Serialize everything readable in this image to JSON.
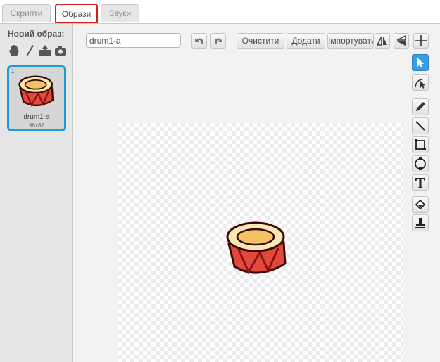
{
  "tabs": [
    {
      "label": "Скрипти"
    },
    {
      "label": "Образи"
    },
    {
      "label": "Звуки"
    }
  ],
  "left_pane": {
    "new_costume_label": "Новий образ:",
    "costume_icons": [
      "sprite-library-icon",
      "paint-brush-icon",
      "upload-icon",
      "camera-icon"
    ],
    "costumes": [
      {
        "number": "1",
        "name": "drum1-a",
        "size": "98x87"
      }
    ]
  },
  "editor": {
    "costume_name_value": "drum1-a",
    "undo_icon": "undo-icon",
    "redo_icon": "redo-icon",
    "clear_label": "Очистити",
    "add_label": "Додати",
    "import_label": "Імпортувати",
    "flip_horizontal_icon": "flip-horizontal-icon",
    "flip_vertical_icon": "flip-vertical-icon",
    "costume_center_icon": "crosshair-icon",
    "tools": [
      "select-icon",
      "reshape-icon",
      "pencil-icon",
      "line-icon",
      "rectangle-icon",
      "ellipse-icon",
      "text-icon",
      "fill-icon",
      "stamp-icon"
    ]
  },
  "colors": {
    "selected_tab_border": "#d32020",
    "selection_blue": "#1f9ad6",
    "drum_red": "#e2493c",
    "drum_cream": "#fbe7b0"
  }
}
